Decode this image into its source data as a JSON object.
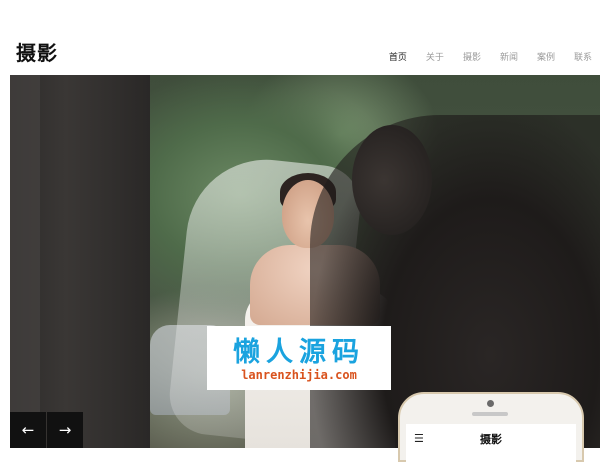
{
  "header": {
    "logo": "摄影",
    "nav": [
      {
        "label": "首页",
        "active": true
      },
      {
        "label": "关于",
        "active": false
      },
      {
        "label": "摄影",
        "active": false
      },
      {
        "label": "新闻",
        "active": false
      },
      {
        "label": "案例",
        "active": false
      },
      {
        "label": "联系",
        "active": false
      }
    ]
  },
  "slider": {
    "prev_icon": "←",
    "next_icon": "→"
  },
  "watermark": {
    "title": "懒人源码",
    "url": "lanrenzhijia.com"
  },
  "phone": {
    "menu_icon": "☰",
    "logo": "摄影"
  },
  "colors": {
    "watermark_title": "#1aa3df",
    "watermark_url": "#d9531e",
    "arrow_bg": "#111111"
  }
}
